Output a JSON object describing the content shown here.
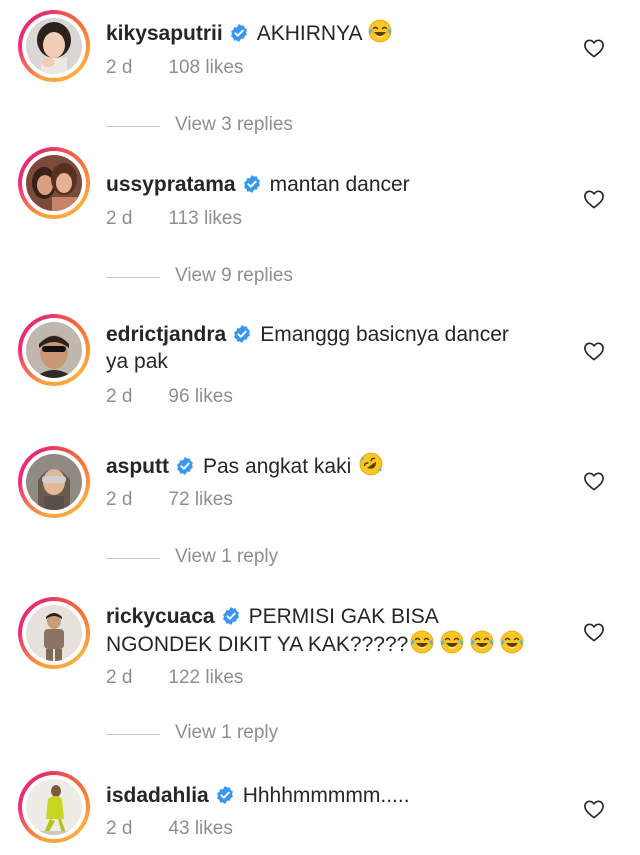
{
  "comments": [
    {
      "username": "kikysaputrii",
      "text": "AKHIRNYA",
      "emoji": [
        "face-with-tears-of-joy"
      ],
      "time": "2 d",
      "likes": "108 likes",
      "replies": "View 3 replies"
    },
    {
      "username": "ussypratama",
      "text": "mantan dancer",
      "emoji": [],
      "time": "2 d",
      "likes": "113 likes",
      "replies": "View 9 replies"
    },
    {
      "username": "edrictjandra",
      "text_line1": "Emanggg basicnya dancer",
      "text_line2": "ya pak",
      "emoji": [],
      "time": "2 d",
      "likes": "96 likes"
    },
    {
      "username": "asputt",
      "text": "Pas angkat kaki",
      "emoji": [
        "rolling-on-floor-laughing"
      ],
      "time": "2 d",
      "likes": "72 likes",
      "replies": "View 1 reply"
    },
    {
      "username": "rickycuaca",
      "text_line1": "PERMISI GAK BISA",
      "text_line2": "NGONDEK DIKIT YA KAK?????",
      "emoji": [
        "face-with-tears-of-joy",
        "face-with-tears-of-joy",
        "face-with-tears-of-joy",
        "face-with-tears-of-joy"
      ],
      "time": "2 d",
      "likes": "122 likes",
      "replies": "View 1 reply"
    },
    {
      "username": "isdadahlia",
      "text": "Hhhhmmmmm.....",
      "emoji": [],
      "time": "2 d",
      "likes": "43 likes"
    }
  ],
  "colors": {
    "verified": "#3897f0",
    "secondary_text": "#8e8e8e",
    "primary_text": "#262626",
    "divider": "#c7c7c7"
  },
  "icons": {
    "like": "heart-outline-icon",
    "verified": "verified-badge-icon"
  }
}
